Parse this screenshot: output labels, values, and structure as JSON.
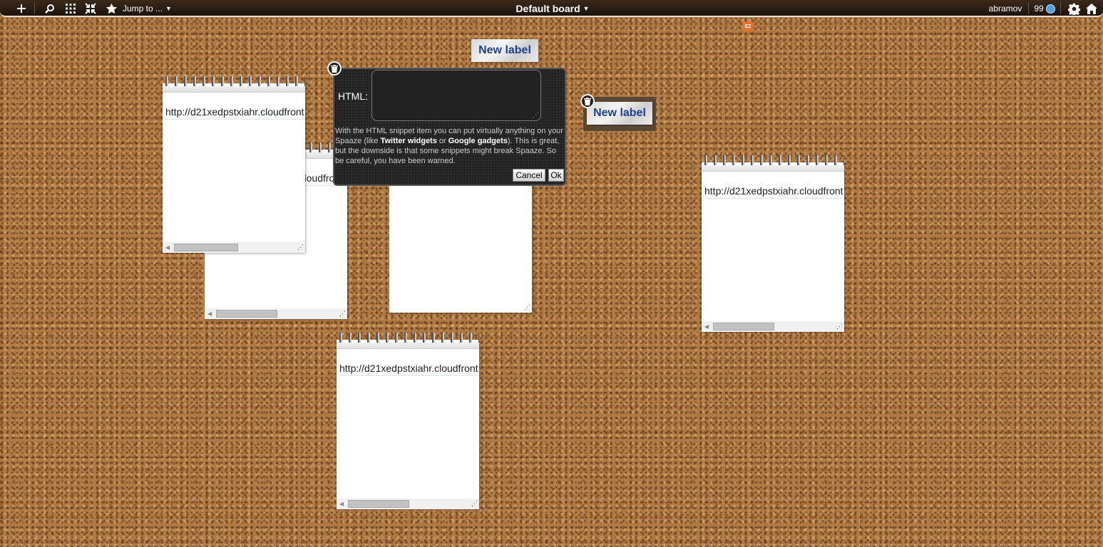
{
  "toolbar": {
    "jump_to_label": "Jump to ...",
    "board_title": "Default board",
    "username": "abramov",
    "score": "99",
    "icons": [
      "plus-icon",
      "search-icon",
      "grid-icon",
      "fit-icon",
      "star-icon",
      "gear-icon",
      "home-icon"
    ]
  },
  "ez_badge": "EZ",
  "labels": [
    {
      "text": "New label"
    },
    {
      "text": "New label"
    }
  ],
  "notepads": [
    {
      "url": "http://d21xedpstxiahr.cloudfront"
    },
    {
      "url": ".cloudfront"
    },
    {
      "url": ""
    },
    {
      "url": "http://d21xedpstxiahr.cloudfront"
    },
    {
      "url": "http://d21xedpstxiahr.cloudfront"
    }
  ],
  "dialog": {
    "field_label": "HTML:",
    "help_pre": "With the HTML snippet item you can put virtually anything on your Spaaze (like ",
    "help_twitter": "Twitter widgets",
    "help_or": " or ",
    "help_google": "Google gadgets",
    "help_post": "). This is great, but the downside is that some snippets might break Spaaze. So be careful, you have been warned.",
    "cancel_label": "Cancel",
    "ok_label": "Ok"
  }
}
